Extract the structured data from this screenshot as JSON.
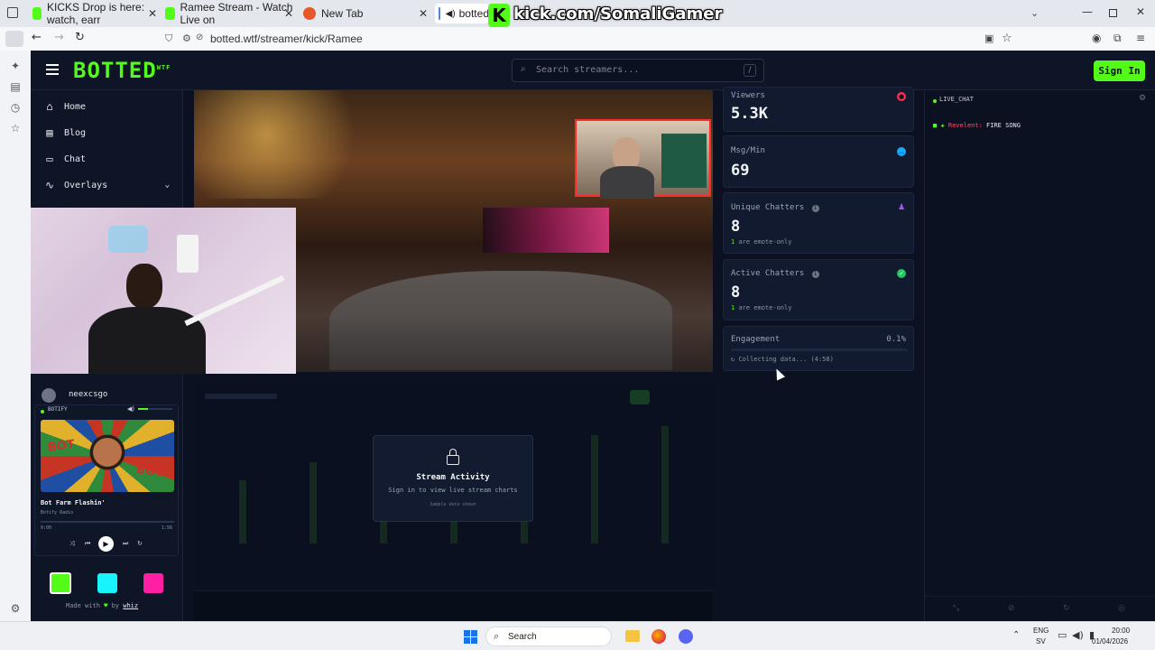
{
  "browser": {
    "tabs": [
      {
        "title": "KICKS Drop is here: watch, earr",
        "favcolor": "#53fc18"
      },
      {
        "title": "Ramee Stream - Watch Live on",
        "favcolor": "#53fc18"
      },
      {
        "title": "New Tab",
        "favcolor": "#e8572a"
      },
      {
        "title": "botted",
        "favcolor": "#4b8bd6"
      }
    ],
    "overlay_url": "kick.com/SomaliGamer",
    "address": "botted.wtf/streamer/kick/Ramee"
  },
  "site": {
    "logo": "BOTTED",
    "logo_sup": "WTF",
    "search_placeholder": "Search streamers...",
    "search_shortcut": "/",
    "signin_label": "Sign In",
    "accent": "#53fc18",
    "nav": [
      {
        "label": "Home",
        "icon": "home-icon"
      },
      {
        "label": "Blog",
        "icon": "document-icon"
      },
      {
        "label": "Chat",
        "icon": "chat-icon"
      },
      {
        "label": "Overlays",
        "icon": "activity-icon"
      }
    ],
    "streamer_name": "neexcsgo",
    "player": {
      "brand": "BOTIFY",
      "track": "Bot Farm Flashin'",
      "artist": "Botify Radio",
      "time_current": "0:00",
      "time_total": "1:56",
      "progress": 0.0
    },
    "footer": {
      "made_with": "Made with",
      "by": "by",
      "author": "whiz"
    },
    "color_swatches": [
      "#53fc18",
      "#18f4fc",
      "#ff1fa5"
    ]
  },
  "stats": {
    "viewers": {
      "label": "Viewers",
      "value": "5.3K"
    },
    "msg_min": {
      "label": "Msg/Min",
      "value": "69"
    },
    "unique": {
      "label": "Unique Chatters",
      "value": "8",
      "sub_count": "1",
      "sub_text": "are emote-only"
    },
    "active": {
      "label": "Active Chatters",
      "value": "8",
      "sub_count": "1",
      "sub_text": "are emote-only"
    },
    "engagement": {
      "label": "Engagement",
      "value": "0.1%",
      "status": "Collecting data... (4:58)",
      "progress": 0.0
    }
  },
  "activity": {
    "title": "Stream Activity",
    "subtitle": "Sign in to view live stream charts",
    "note": "Sample data shown"
  },
  "chat": {
    "title": "LIVE_CHAT",
    "messages": [
      {
        "user": "Revelent:",
        "text": "FIRE SONG"
      }
    ]
  },
  "taskbar": {
    "search": "Search",
    "lang": "ENG",
    "lang2": "SV",
    "time": "20:00",
    "date": "01/04/2026"
  }
}
